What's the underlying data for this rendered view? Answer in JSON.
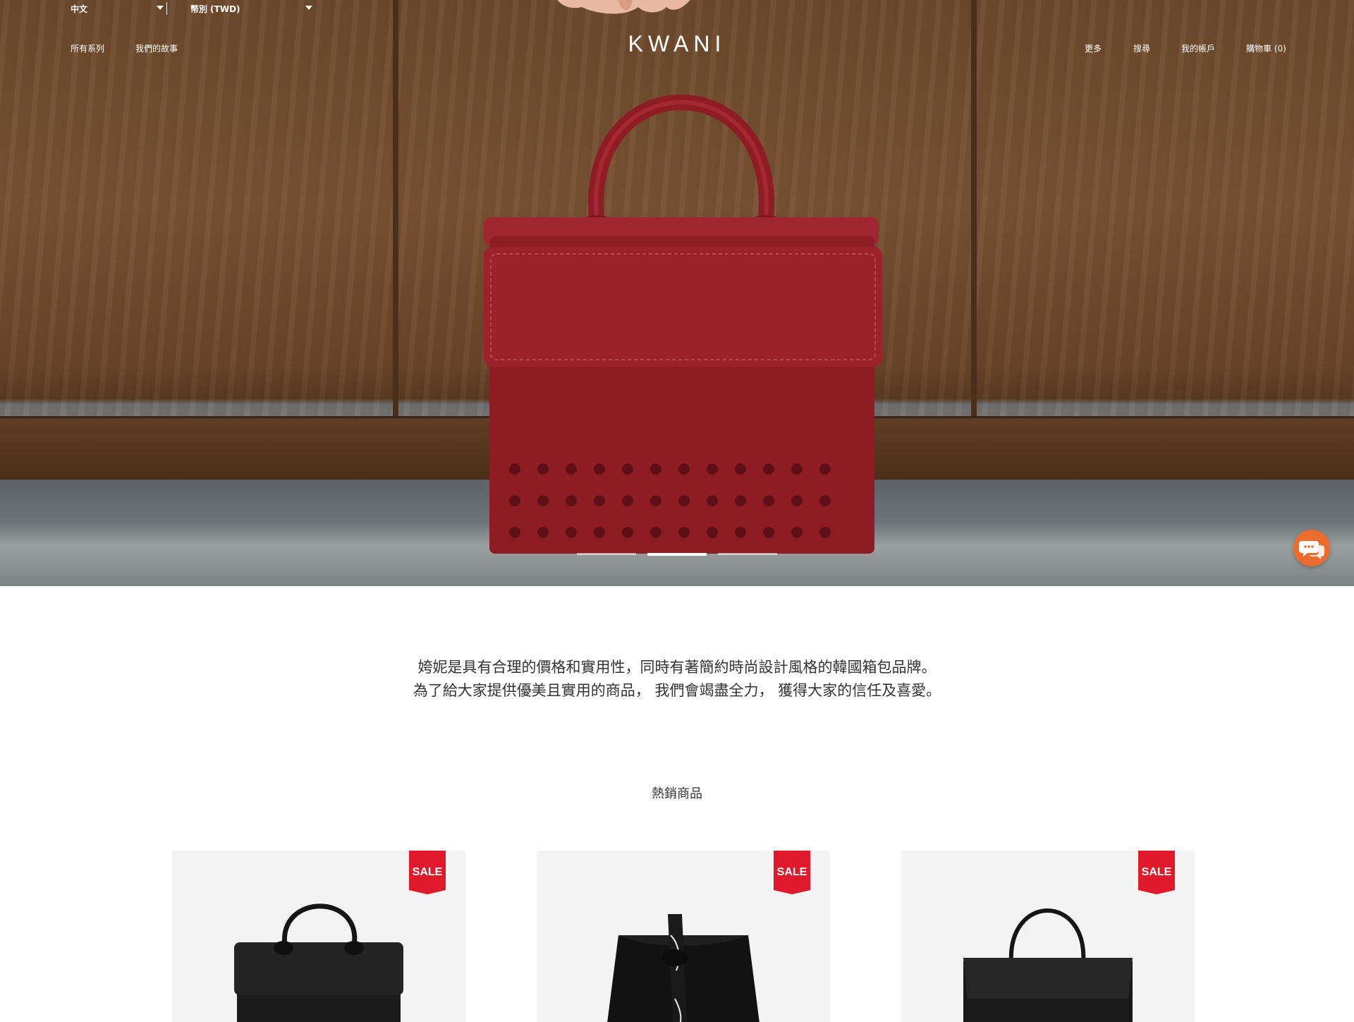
{
  "header": {
    "language_label": "中文",
    "currency_label": "幣別 (TWD)",
    "brand": "KWANI",
    "nav_left": [
      {
        "label": "所有系列"
      },
      {
        "label": "我們的故事"
      }
    ],
    "nav_right": [
      {
        "label": "更多"
      },
      {
        "label": "搜尋"
      },
      {
        "label": "我的帳戶"
      },
      {
        "label": "購物車 (0)"
      }
    ]
  },
  "hero": {
    "slides_total": 3,
    "active_slide": 2,
    "bag_color": "#8e1c25"
  },
  "intro": {
    "line1": "姱妮是具有合理的價格和實用性，同時有著簡約時尚設計風格的韓國箱包品牌。",
    "line2": "為了給大家提供優美且實用的商品， 我們會竭盡全力， 獲得大家的信任及喜愛。"
  },
  "bestsellers": {
    "title": "熱銷商品",
    "products": [
      {
        "badge": "SALE"
      },
      {
        "badge": "SALE"
      },
      {
        "badge": "SALE"
      }
    ]
  },
  "colors": {
    "sale_badge": "#e0192b",
    "chat_button": "#ec6b2d"
  },
  "icons": {
    "chat": "chat-bubbles-icon",
    "dropdown": "caret-down-icon"
  }
}
